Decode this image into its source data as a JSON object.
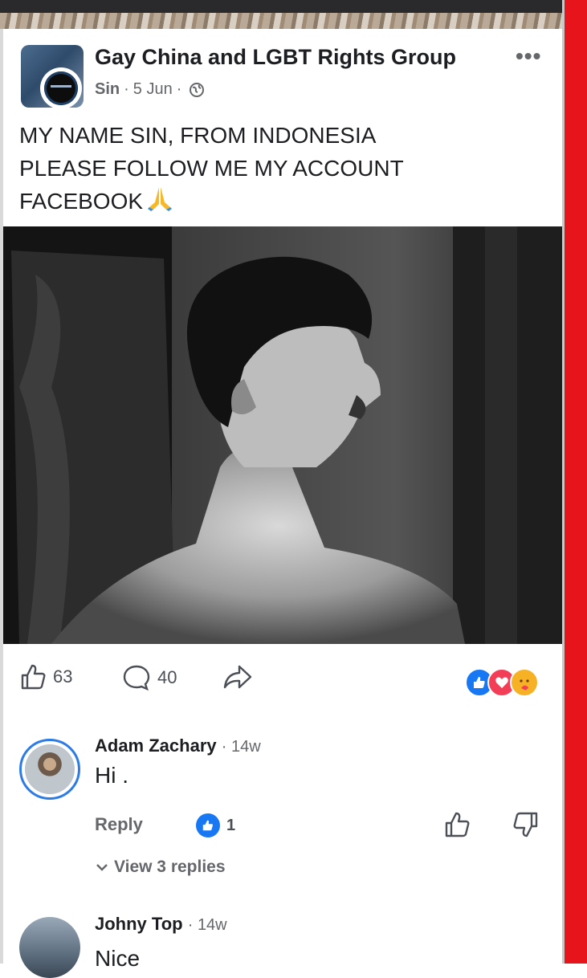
{
  "post": {
    "group_name": "Gay China and LGBT Rights Group",
    "author": "Sin",
    "date": "5 Jun",
    "text_lines": [
      "MY NAME SIN, FROM INDONESIA",
      "PLEASE FOLLOW ME MY ACCOUNT",
      "FACEBOOK"
    ],
    "likes": "63",
    "comments": "40",
    "more_label": "•••"
  },
  "comments": [
    {
      "name": "Adam Zachary",
      "time": "14w",
      "text": "Hi .",
      "reply_label": "Reply",
      "like_count": "1",
      "view_replies_label": "View 3 replies"
    },
    {
      "name": "Johny Top",
      "time": "14w",
      "text": "Nice"
    }
  ],
  "colors": {
    "facebook_blue": "#1877f2",
    "border_red": "#e8141b",
    "muted_text": "#65676b"
  }
}
